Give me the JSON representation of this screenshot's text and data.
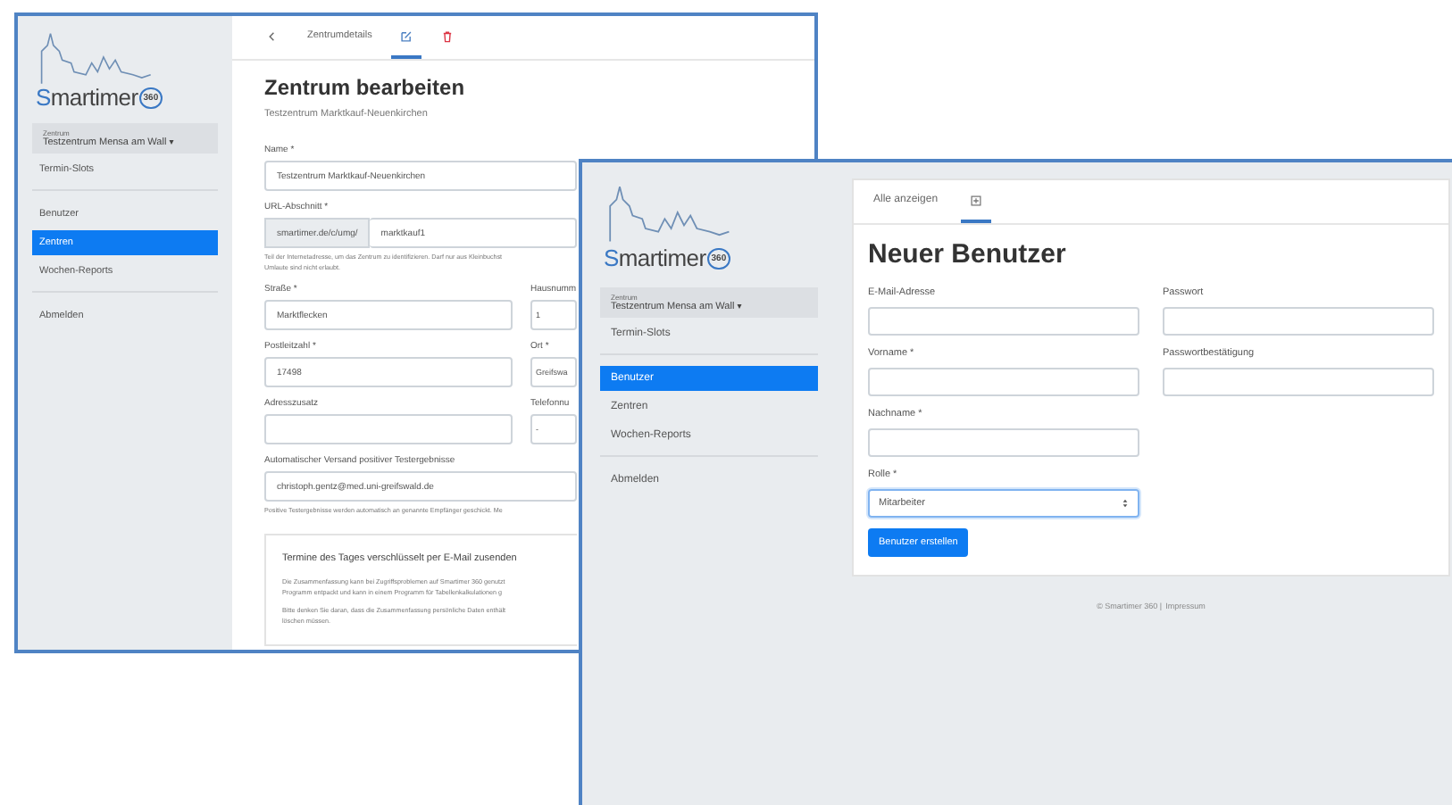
{
  "windows": [
    {
      "logo": {
        "name": "Smartimer",
        "badge": "360"
      },
      "center_select": {
        "label": "Zentrum",
        "value": "Testzentrum Mensa am Wall",
        "caret": "▾"
      },
      "nav_groups": [
        [
          {
            "label": "Termin-Slots",
            "selected": false
          }
        ],
        [
          {
            "label": "Benutzer",
            "selected": false
          },
          {
            "label": "Zentren",
            "selected": true
          },
          {
            "label": "Wochen-Reports",
            "selected": false
          }
        ],
        [
          {
            "label": "Abmelden",
            "selected": false
          }
        ]
      ],
      "tabs": [
        {
          "kind": "back",
          "selected": false
        },
        {
          "kind": "text",
          "label": "Zentrumdetails",
          "selected": false
        },
        {
          "kind": "edit",
          "selected": true
        },
        {
          "kind": "delete",
          "selected": false
        }
      ],
      "title": "Zentrum bearbeiten",
      "subtitle": "Testzentrum Marktkauf-Neuenkirchen",
      "rows": [
        [
          {
            "label": "Name *",
            "value": "Testzentrum Marktkauf-Neuenkirchen"
          }
        ],
        [
          {
            "label": "URL-Abschnitt *",
            "prefix": "smartimer.de/c/umg/",
            "value": "marktkauf1",
            "help": [
              "Teil der Internetadresse, um das Zentrum zu identifizieren. Darf nur aus Kleinbuchst",
              "Umlaute sind nicht erlaubt."
            ]
          }
        ],
        [
          {
            "label": "Straße *",
            "value": "Marktflecken"
          },
          {
            "label": "Hausnumm",
            "value": "1"
          }
        ],
        [
          {
            "label": "Postleitzahl *",
            "value": "17498"
          },
          {
            "label": "Ort *",
            "value": "Greifswa"
          }
        ],
        [
          {
            "label": "Adresszusatz"
          },
          {
            "label": "Telefonnu",
            "value": "-"
          }
        ],
        [
          {
            "label": "Automatischer Versand positiver Testergebnisse",
            "value": "christoph.gentz@med.uni-greifswald.de",
            "help": [
              "Positive Testergebnisse werden automatisch an genannte Empfänger geschickt. Me"
            ]
          }
        ]
      ],
      "notice": {
        "title": "Termine des Tages verschlüsselt per E-Mail zusenden",
        "paragraphs": [
          [
            "Die Zusammenfassung kann bei Zugriffsproblemen auf Smartimer 360 genutzt",
            "Programm entpackt und kann in einem Programm für Tabellenkalkulationen g"
          ],
          [
            "Bitte denken Sie daran, dass die Zusammenfassung persönliche Daten enthält",
            "löschen müssen."
          ]
        ]
      }
    },
    {
      "logo": {
        "name": "Smartimer",
        "badge": "360"
      },
      "center_select": {
        "label": "Zentrum",
        "value": "Testzentrum Mensa am Wall",
        "caret": "▾"
      },
      "nav_groups": [
        [
          {
            "label": "Termin-Slots",
            "selected": false
          }
        ],
        [
          {
            "label": "Benutzer",
            "selected": true
          },
          {
            "label": "Zentren",
            "selected": false
          },
          {
            "label": "Wochen-Reports",
            "selected": false
          }
        ],
        [
          {
            "label": "Abmelden",
            "selected": false
          }
        ]
      ],
      "tabs": [
        {
          "kind": "text",
          "label": "Alle anzeigen",
          "selected": false
        },
        {
          "kind": "add",
          "selected": true
        }
      ],
      "title": "Neuer Benutzer",
      "fields": [
        {
          "label": "E-Mail-Adresse"
        },
        {
          "label": "Passwort"
        },
        {
          "label": "Vorname *"
        },
        {
          "label": "Passwortbestätigung"
        },
        {
          "label": "Nachname *"
        }
      ],
      "role": {
        "label": "Rolle *",
        "value": "Mitarbeiter"
      },
      "submit": "Benutzer erstellen",
      "footer": {
        "text": "© Smartimer 360 |",
        "link": "Impressum"
      }
    }
  ]
}
